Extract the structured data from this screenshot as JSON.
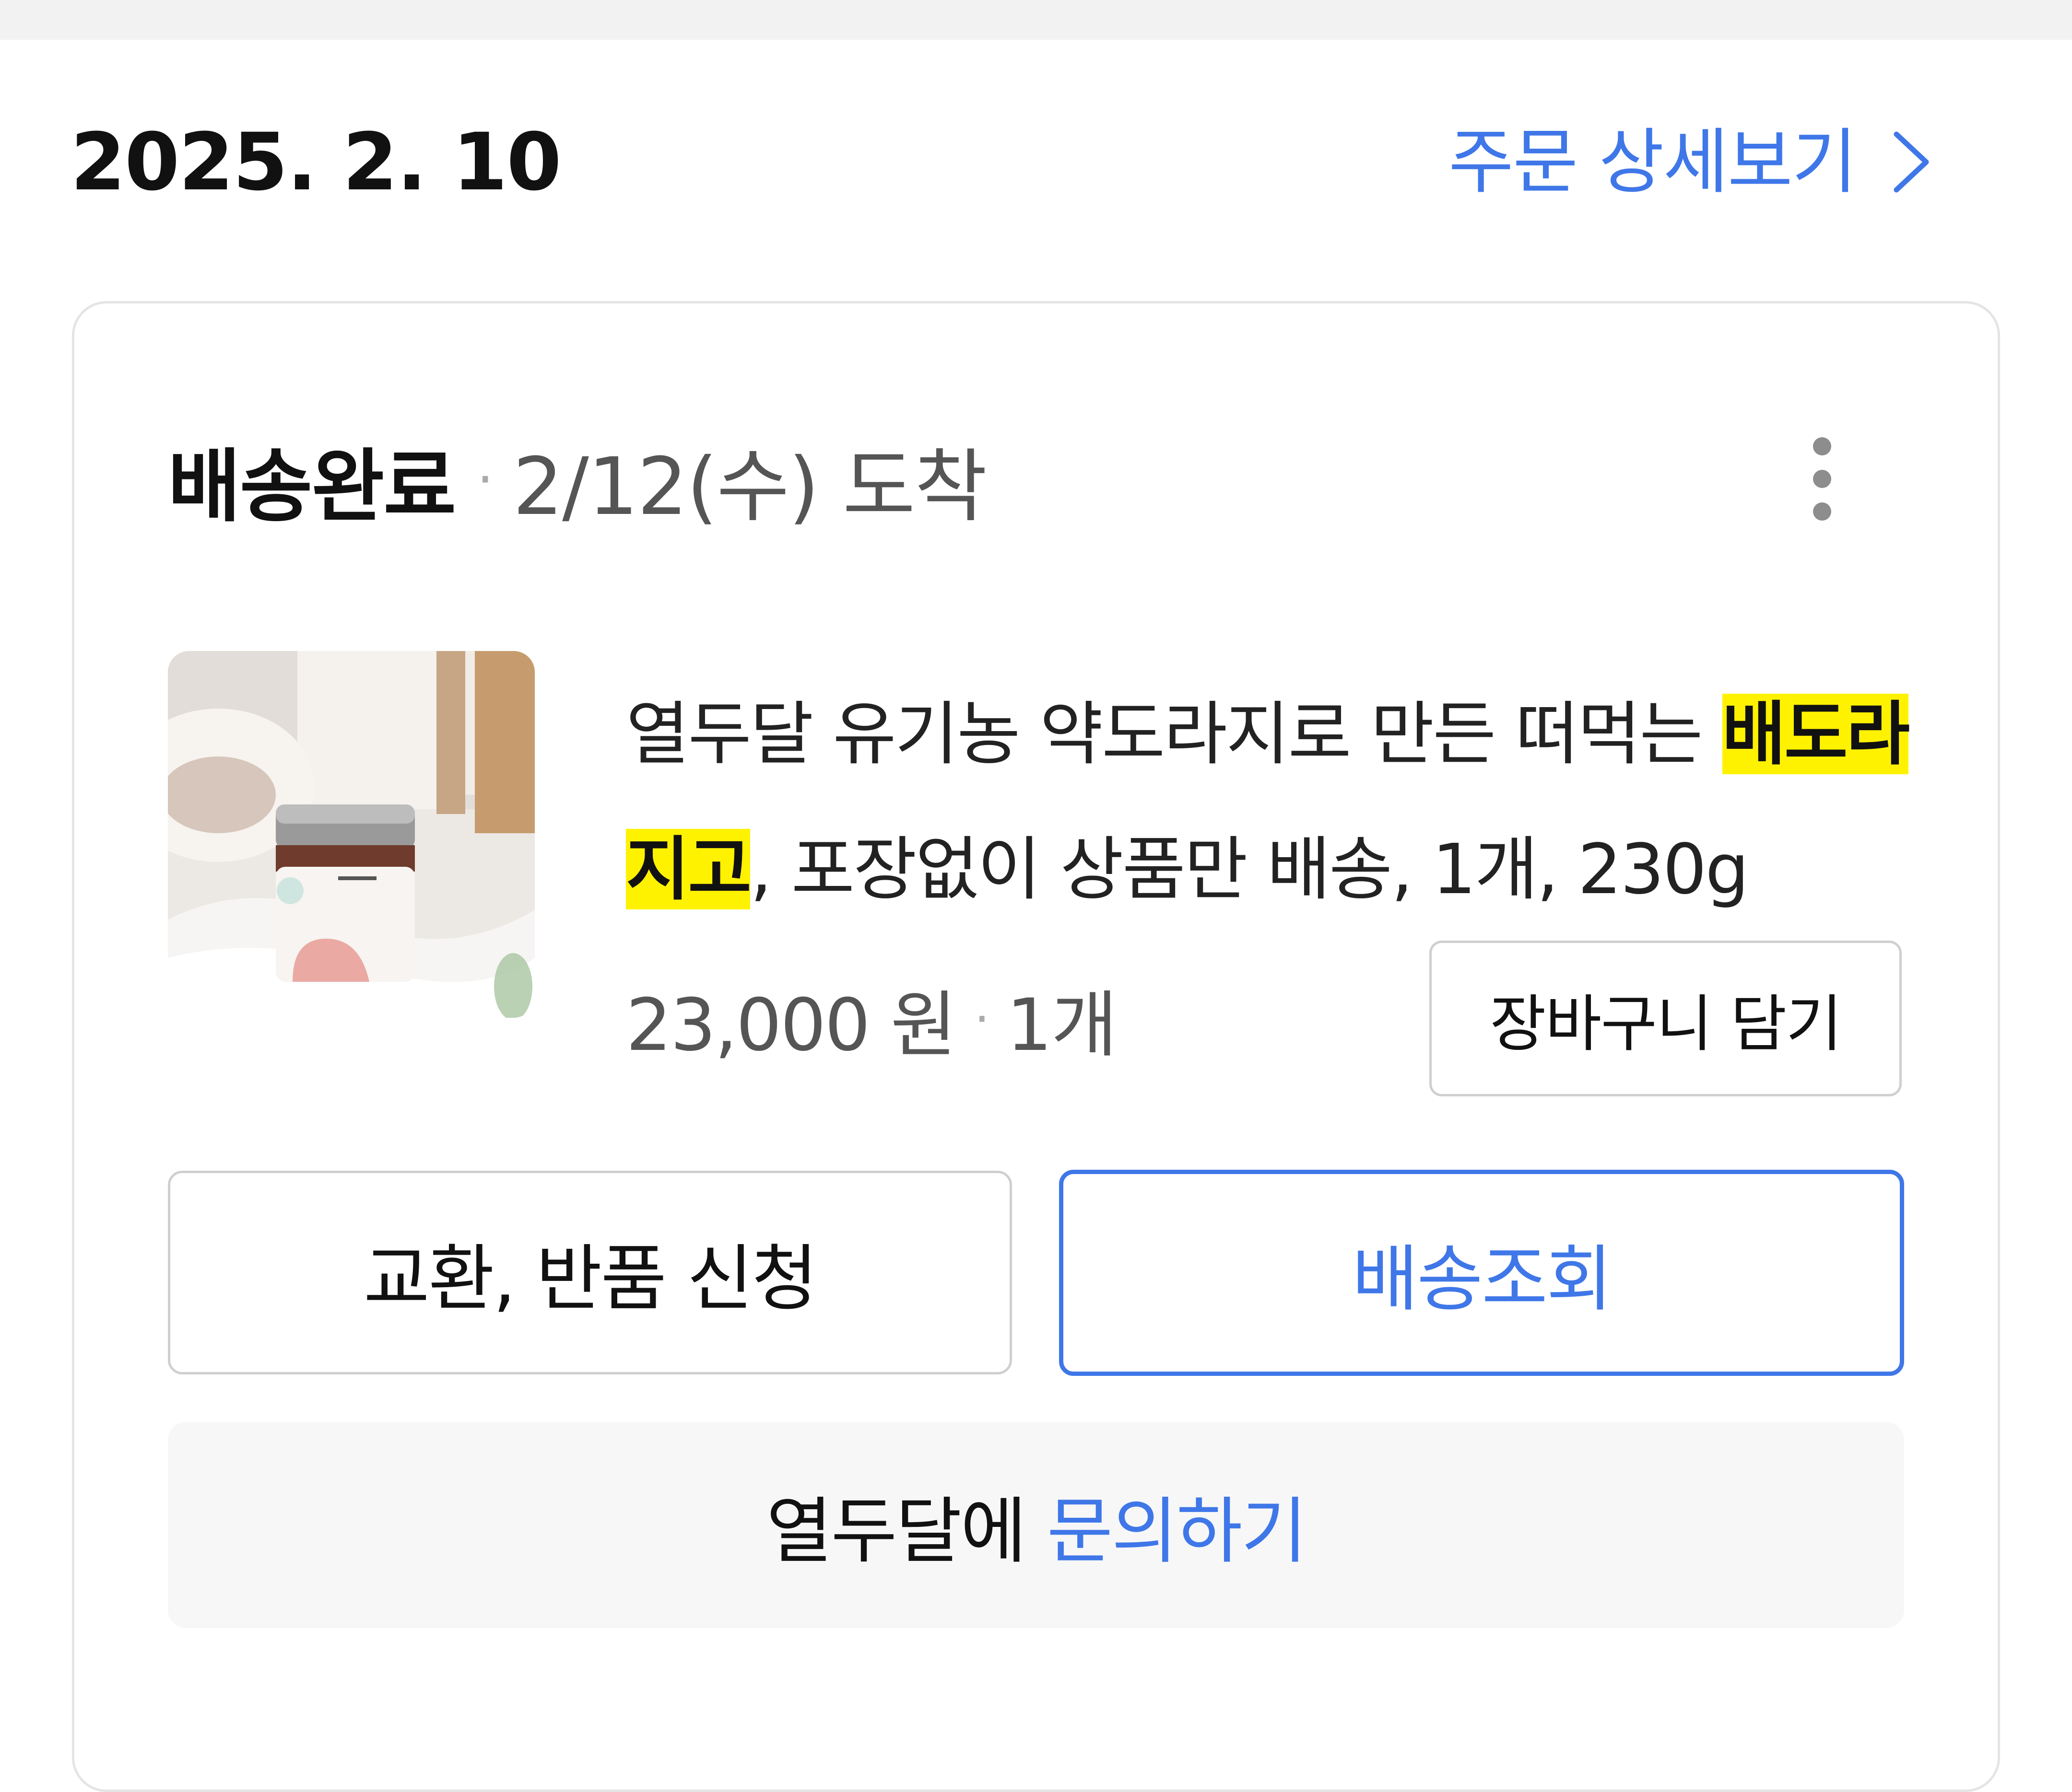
{
  "header": {
    "order_date": "2025. 2. 10",
    "detail_link_label": "주문 상세보기",
    "detail_link_icon": "chevron-right-icon"
  },
  "order_card": {
    "status": "배송완료",
    "separator": "·",
    "arrival": "2/12(수) 도착",
    "more_icon": "more-vertical-icon",
    "product": {
      "thumbnail_icon": "product-jar-image",
      "title_prefix": "열두달 유기농 약도라지로 만든 떠먹는 ",
      "title_highlight": "배도라지고",
      "title_suffix": ", 포장없이 상품만 배송, 1개, 230g",
      "price": "23,000 원",
      "quantity": "1개"
    },
    "buttons": {
      "cart": "장바구니 담기",
      "return_exchange": "교환, 반품 신청",
      "track_delivery": "배송조회"
    },
    "inquiry": {
      "seller_text": "열두달에",
      "link_text": "문의하기"
    }
  },
  "colors": {
    "accent_blue": "#3f77e8",
    "highlight_yellow": "#fff200",
    "border_gray": "#cfcfcf",
    "inquiry_bg": "#f7f7f8"
  }
}
